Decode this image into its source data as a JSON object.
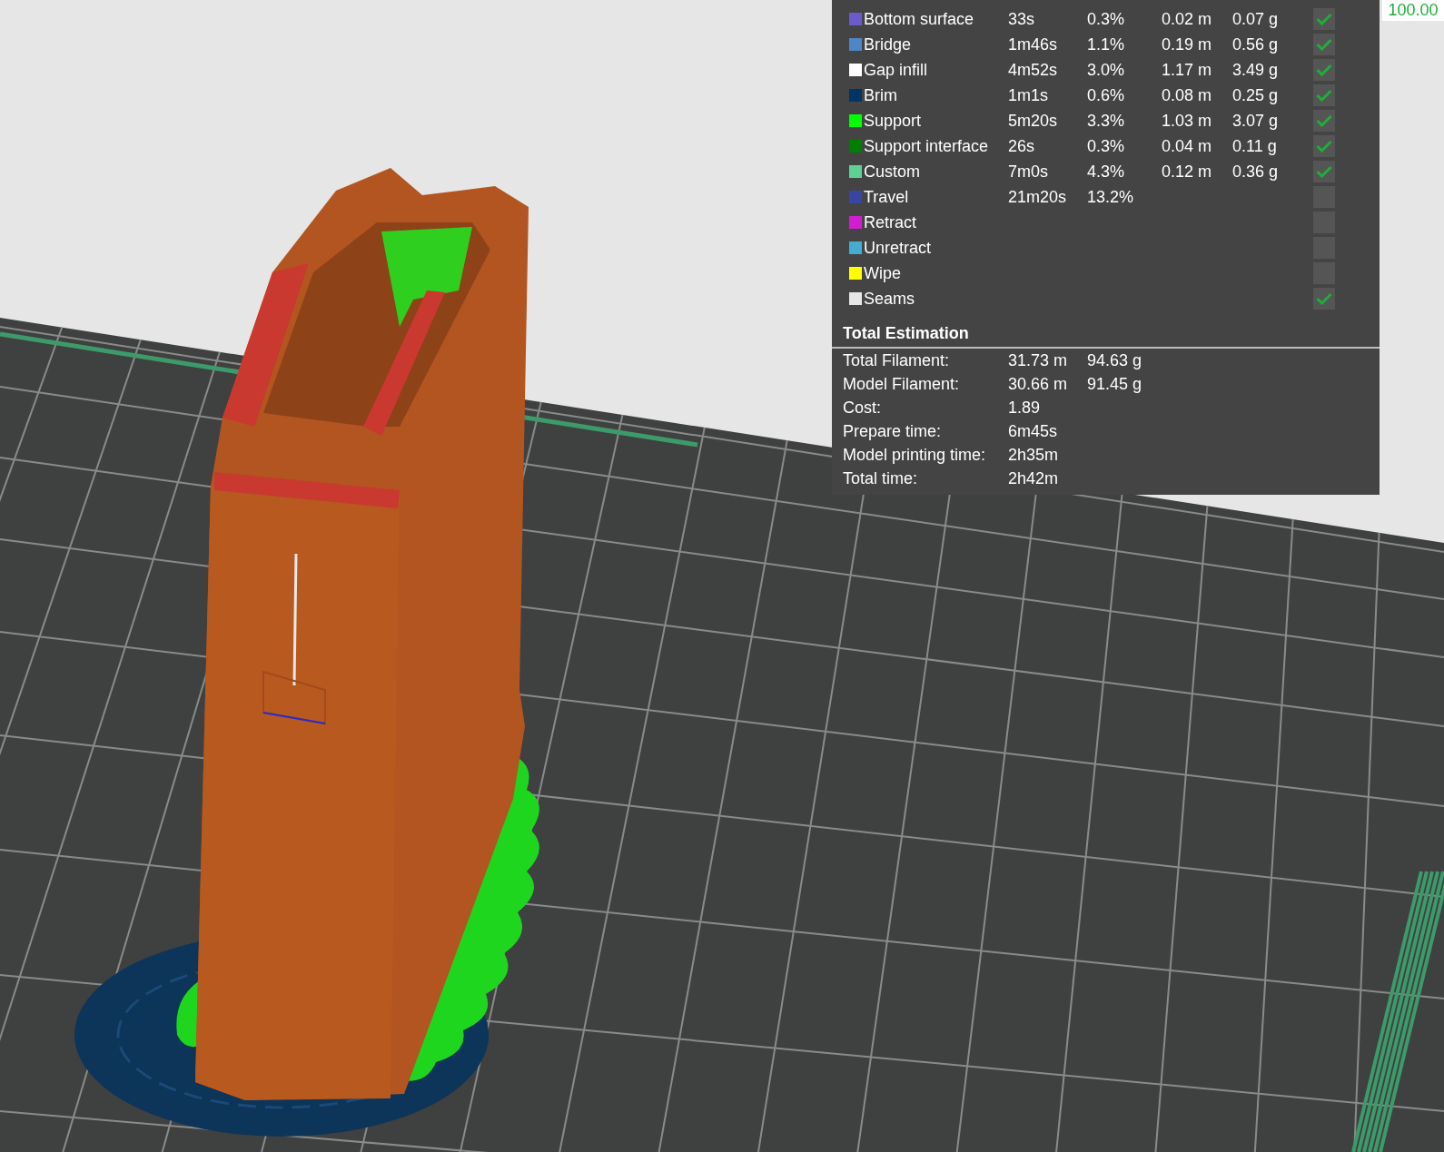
{
  "legend": {
    "rows": [
      {
        "name": "Bottom surface",
        "color": "#6a5acd",
        "time": "33s",
        "percent": "0.3%",
        "length": "0.02 m",
        "weight": "0.07 g",
        "checked": true
      },
      {
        "name": "Bridge",
        "color": "#4f86c6",
        "time": "1m46s",
        "percent": "1.1%",
        "length": "0.19 m",
        "weight": "0.56 g",
        "checked": true
      },
      {
        "name": "Gap infill",
        "color": "#ffffff",
        "time": "4m52s",
        "percent": "3.0%",
        "length": "1.17 m",
        "weight": "3.49 g",
        "checked": true
      },
      {
        "name": "Brim",
        "color": "#003366",
        "time": "1m1s",
        "percent": "0.6%",
        "length": "0.08 m",
        "weight": "0.25 g",
        "checked": true
      },
      {
        "name": "Support",
        "color": "#00ff00",
        "time": "5m20s",
        "percent": "3.3%",
        "length": "1.03 m",
        "weight": "3.07 g",
        "checked": true
      },
      {
        "name": "Support interface",
        "color": "#007f00",
        "time": "26s",
        "percent": "0.3%",
        "length": "0.04 m",
        "weight": "0.11 g",
        "checked": true
      },
      {
        "name": "Custom",
        "color": "#5ed194",
        "time": "7m0s",
        "percent": "4.3%",
        "length": "0.12 m",
        "weight": "0.36 g",
        "checked": true
      },
      {
        "name": "Travel",
        "color": "#3845a5",
        "time": "21m20s",
        "percent": "13.2%",
        "checked": false
      },
      {
        "name": "Retract",
        "color": "#d21ed2",
        "checked": false
      },
      {
        "name": "Unretract",
        "color": "#44acd2",
        "checked": false
      },
      {
        "name": "Wipe",
        "color": "#ffff00",
        "checked": false
      },
      {
        "name": "Seams",
        "color": "#e6e6e6",
        "checked": true
      }
    ]
  },
  "total_estimation": {
    "title": "Total Estimation",
    "rows": [
      {
        "label": "Total Filament:",
        "values": [
          "31.73 m",
          "94.63 g"
        ]
      },
      {
        "label": "Model Filament:",
        "values": [
          "30.66 m",
          "91.45 g"
        ]
      },
      {
        "label": "Cost:",
        "values": [
          "1.89"
        ]
      },
      {
        "label": "Prepare time:",
        "values": [
          "6m45s"
        ]
      },
      {
        "label": "Model printing time:",
        "values": [
          "2h35m"
        ]
      },
      {
        "label": "Total time:",
        "values": [
          "2h42m"
        ]
      }
    ]
  },
  "slider_value": "100.00"
}
